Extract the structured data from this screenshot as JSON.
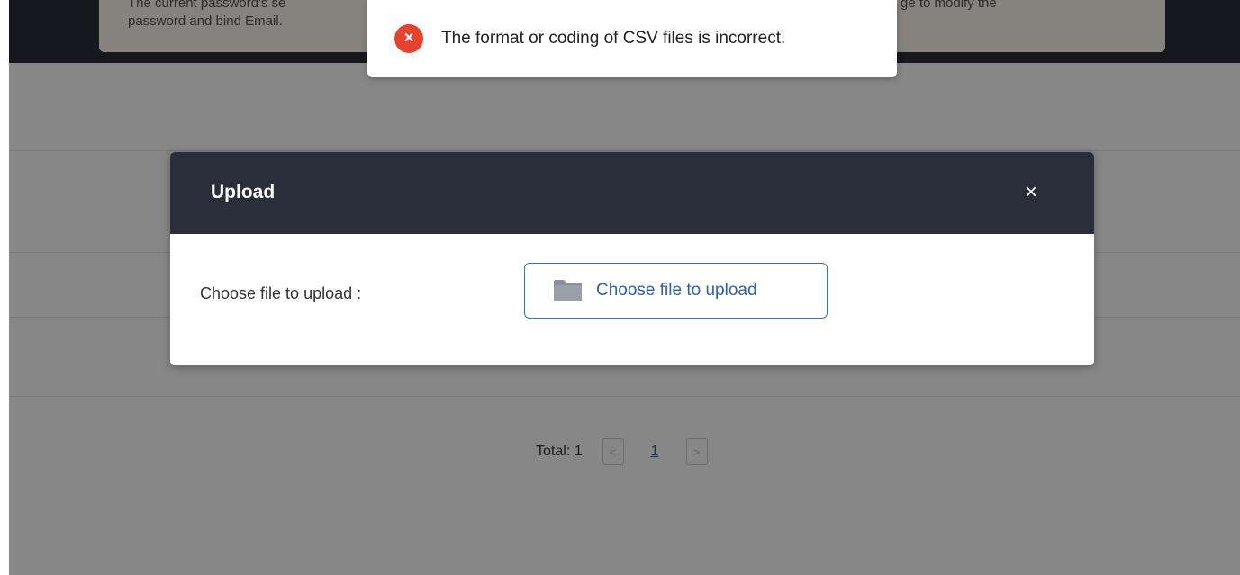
{
  "notice": {
    "line1_start": "The current password's se",
    "line1_end": "ge to modify the",
    "line2": "password and bind Email."
  },
  "pagination": {
    "total_label": "Total: 1",
    "prev": "<",
    "page": "1",
    "next": ">"
  },
  "modal": {
    "title": "Upload",
    "close": "×",
    "field_label": "Choose file to upload :",
    "button_label": "Choose file to upload"
  },
  "toast": {
    "icon": "×",
    "message": "The format or coding of CSV files is incorrect."
  },
  "colors": {
    "header_dark": "#2a2e3b",
    "error_red": "#e5422f",
    "link_blue": "#2d62a8"
  },
  "icons": [
    "error-icon",
    "close-icon",
    "folder-icon",
    "chevron-left-icon",
    "chevron-right-icon"
  ]
}
